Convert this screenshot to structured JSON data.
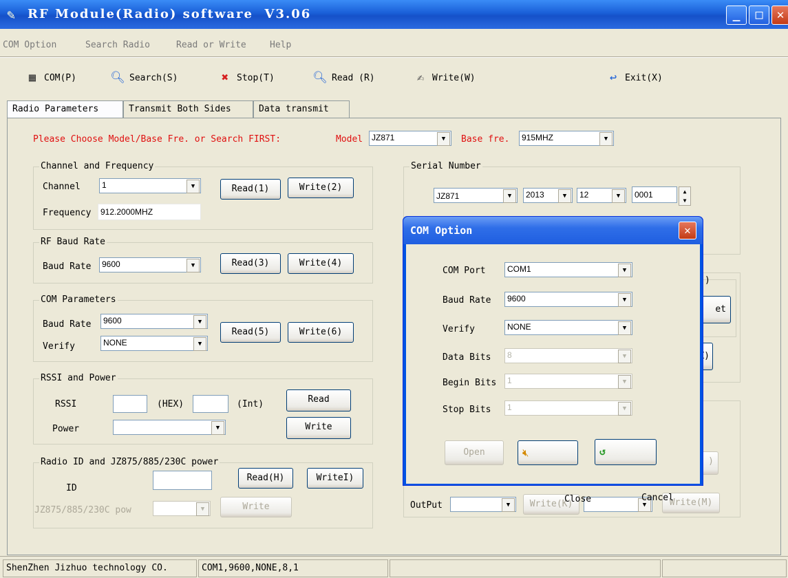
{
  "window": {
    "title": "RF Module(Radio) software  V3.06",
    "min": "_",
    "max": "□",
    "close": "✕"
  },
  "menu": [
    "COM Option",
    "Search Radio",
    "Read or Write",
    "Help"
  ],
  "toolbar": {
    "com": "COM(P)",
    "search": "Search(S)",
    "stop": "Stop(T)",
    "read": "Read (R)",
    "write": "Write(W)",
    "exit": "Exit(X)"
  },
  "tabs": [
    "Radio Parameters",
    "Transmit Both Sides",
    "Data transmit"
  ],
  "choose": {
    "prompt": "Please Choose Model/Base Fre. or Search FIRST:",
    "model_label": "Model",
    "model": "JZ871",
    "base_label": "Base fre.",
    "base": "915MHZ"
  },
  "channel_group": {
    "title": "Channel and Frequency",
    "channel_label": "Channel",
    "channel": "1",
    "frequency_label": "Frequency",
    "frequency": "912.2000MHZ",
    "read": "Read(1)",
    "write": "Write(2)"
  },
  "rf_group": {
    "title": "RF Baud Rate",
    "baud_label": "Baud Rate",
    "baud": "9600",
    "read": "Read(3)",
    "write": "Write(4)"
  },
  "com_group": {
    "title": "COM Parameters",
    "baud_label": "Baud Rate",
    "baud": "9600",
    "verify_label": "Verify",
    "verify": "NONE",
    "read": "Read(5)",
    "write": "Write(6)"
  },
  "rssi_group": {
    "title": "RSSI and Power",
    "rssi_label": "RSSI",
    "hex": "(HEX)",
    "int": "(Int)",
    "power_label": "Power",
    "read": "Read",
    "write": "Write"
  },
  "radioid_group": {
    "title": "Radio ID and JZ875/885/230C power",
    "id_label": "ID",
    "read": "Read(H)",
    "write": "WriteI)",
    "pow_label": "JZ875/885/230C pow",
    "pow_write": "Write"
  },
  "serial_group": {
    "title": "Serial Number",
    "model": "JZ871",
    "year": "2013",
    "month": "12",
    "num": "0001"
  },
  "right_partial": {
    "paren_frag": ")",
    "btn1_frag": "et",
    "btn2_frag": "Z)",
    "btn3_frag": ")",
    "output_label": "OutPut",
    "write_k": "Write(K)",
    "write_m": "Write(M)"
  },
  "dialog": {
    "title": "COM Option",
    "com_port_label": "COM Port",
    "com_port": "COM1",
    "baud_label": "Baud Rate",
    "baud": "9600",
    "verify_label": "Verify",
    "verify": "NONE",
    "data_bits_label": "Data Bits",
    "data_bits": "8",
    "begin_bits_label": "Begin Bits",
    "begin_bits": "1",
    "stop_bits_label": "Stop Bits",
    "stop_bits": "1",
    "open": "Open",
    "close": "Close",
    "cancel": "Cancel"
  },
  "status": {
    "company": "ShenZhen Jizhuo technology CO.",
    "port": "COM1,9600,NONE,8,1"
  }
}
